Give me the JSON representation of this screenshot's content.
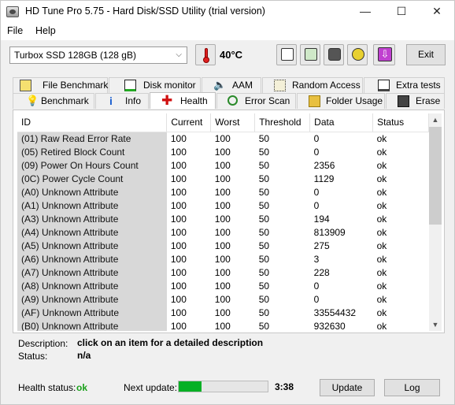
{
  "window": {
    "title": "HD Tune Pro 5.75 - Hard Disk/SSD Utility (trial version)",
    "minimize": "—",
    "maximize": "☐",
    "close": "✕"
  },
  "menu": {
    "file": "File",
    "help": "Help"
  },
  "toolbar": {
    "drive": "Turbox SSD 128GB (128 gB)",
    "temperature": "40°C",
    "exit_label": "Exit",
    "icons": [
      "copy-text-icon",
      "copy-screen-icon",
      "camera-icon",
      "options-icon",
      "save-down-icon"
    ]
  },
  "tabs_top": [
    {
      "label": "File Benchmark",
      "icon": "file-benchmark-icon"
    },
    {
      "label": "Disk monitor",
      "icon": "disk-monitor-icon"
    },
    {
      "label": "AAM",
      "icon": "speaker-icon"
    },
    {
      "label": "Random Access",
      "icon": "random-access-icon"
    },
    {
      "label": "Extra tests",
      "icon": "extra-tests-icon"
    }
  ],
  "tabs_bottom": [
    {
      "label": "Benchmark",
      "icon": "benchmark-icon"
    },
    {
      "label": "Info",
      "icon": "info-icon"
    },
    {
      "label": "Health",
      "icon": "health-cross-icon",
      "active": true
    },
    {
      "label": "Error Scan",
      "icon": "magnifier-icon"
    },
    {
      "label": "Folder Usage",
      "icon": "folder-icon"
    },
    {
      "label": "Erase",
      "icon": "trash-icon"
    }
  ],
  "table": {
    "headers": [
      "ID",
      "Current",
      "Worst",
      "Threshold",
      "Data",
      "Status"
    ],
    "rows": [
      [
        "(01) Raw Read Error Rate",
        "100",
        "100",
        "50",
        "0",
        "ok"
      ],
      [
        "(05) Retired Block Count",
        "100",
        "100",
        "50",
        "0",
        "ok"
      ],
      [
        "(09) Power On Hours Count",
        "100",
        "100",
        "50",
        "2356",
        "ok"
      ],
      [
        "(0C) Power Cycle Count",
        "100",
        "100",
        "50",
        "1129",
        "ok"
      ],
      [
        "(A0) Unknown Attribute",
        "100",
        "100",
        "50",
        "0",
        "ok"
      ],
      [
        "(A1) Unknown Attribute",
        "100",
        "100",
        "50",
        "0",
        "ok"
      ],
      [
        "(A3) Unknown Attribute",
        "100",
        "100",
        "50",
        "194",
        "ok"
      ],
      [
        "(A4) Unknown Attribute",
        "100",
        "100",
        "50",
        "813909",
        "ok"
      ],
      [
        "(A5) Unknown Attribute",
        "100",
        "100",
        "50",
        "275",
        "ok"
      ],
      [
        "(A6) Unknown Attribute",
        "100",
        "100",
        "50",
        "3",
        "ok"
      ],
      [
        "(A7) Unknown Attribute",
        "100",
        "100",
        "50",
        "228",
        "ok"
      ],
      [
        "(A8) Unknown Attribute",
        "100",
        "100",
        "50",
        "0",
        "ok"
      ],
      [
        "(A9) Unknown Attribute",
        "100",
        "100",
        "50",
        "0",
        "ok"
      ],
      [
        "(AF) Unknown Attribute",
        "100",
        "100",
        "50",
        "33554432",
        "ok"
      ],
      [
        "(B0) Unknown Attribute",
        "100",
        "100",
        "50",
        "932630",
        "ok"
      ]
    ]
  },
  "description": {
    "label": "Description:",
    "value": "click on an item for a detailed description",
    "status_label": "Status:",
    "status_value": "n/a"
  },
  "footer": {
    "health_label": "Health status:",
    "health_value": "ok",
    "next_update_label": "Next update:",
    "next_update_progress": 0.26,
    "timer": "3:38",
    "update_button": "Update",
    "log_button": "Log"
  },
  "colors": {
    "health_ok": "#1aa01a",
    "progress": "#06b025",
    "id_column": "#d8d8d8",
    "exit_icon": "#c040d0"
  }
}
